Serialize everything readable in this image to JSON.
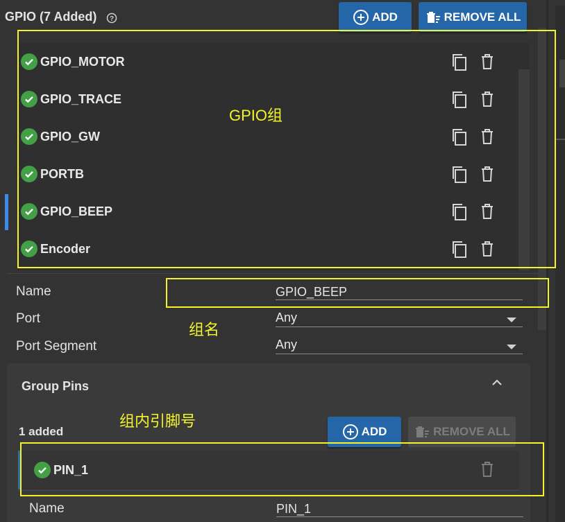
{
  "header": {
    "title": "GPIO (7 Added)",
    "add_label": "ADD",
    "remove_all_label": "REMOVE ALL"
  },
  "gpio_list": [
    {
      "label": "GPIO_MOTOR"
    },
    {
      "label": "GPIO_TRACE"
    },
    {
      "label": "GPIO_GW"
    },
    {
      "label": "PORTB"
    },
    {
      "label": "GPIO_BEEP",
      "selected": true
    },
    {
      "label": "Encoder"
    }
  ],
  "form": {
    "name_label": "Name",
    "name_value": "GPIO_BEEP",
    "port_label": "Port",
    "port_value": "Any",
    "segment_label": "Port Segment",
    "segment_value": "Any"
  },
  "group_pins": {
    "title": "Group Pins",
    "count": "1 added",
    "add_label": "ADD",
    "remove_all_label": "REMOVE ALL",
    "pins": [
      {
        "label": "PIN_1"
      }
    ],
    "name_label": "Name",
    "name_value": "PIN_1"
  },
  "annotations": {
    "group": "GPIO组",
    "group_name": "组名",
    "pins": "组内引脚号"
  },
  "colors": {
    "accent": "#2466a8",
    "success": "#43a047",
    "annotation": "#f4f42a",
    "selection_bar": "#3d8be8"
  },
  "icons": [
    "help-circle-icon",
    "add-circle-icon",
    "delete-sweep-icon",
    "check-circle-icon",
    "copy-icon",
    "trash-icon",
    "chevron-up-icon",
    "dropdown-arrow-icon"
  ]
}
